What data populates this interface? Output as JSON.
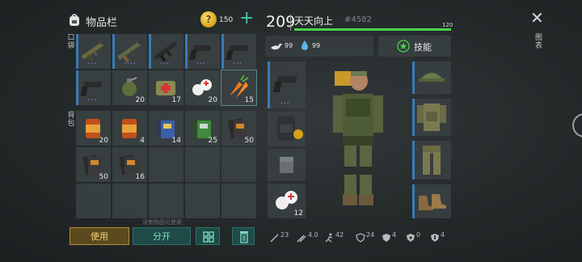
{
  "inventory": {
    "title": "物品栏",
    "coins": "150",
    "coin_symbol": "?",
    "plus_label": "+",
    "pocket_label": "口袋",
    "backpack_label": "背包",
    "pocket_items": [
      {
        "name": "rifle-ak",
        "count": "",
        "dots": "•••"
      },
      {
        "name": "rifle-camo",
        "count": "",
        "dots": "••••"
      },
      {
        "name": "rifle-black",
        "count": "",
        "dots": "•••"
      },
      {
        "name": "pistol",
        "count": "",
        "dots": "•••"
      },
      {
        "name": "pistol",
        "count": "",
        "dots": "•••"
      },
      {
        "name": "pistol",
        "count": "",
        "dots": "•••"
      },
      {
        "name": "grenade",
        "count": "20",
        "dots": ""
      },
      {
        "name": "first-aid-kit",
        "count": "17",
        "dots": ""
      },
      {
        "name": "bandage",
        "count": "20",
        "dots": ""
      },
      {
        "name": "carrots",
        "count": "15",
        "dots": ""
      }
    ],
    "backpack_items": [
      {
        "name": "canned-food",
        "count": "20"
      },
      {
        "name": "canned-food",
        "count": "4"
      },
      {
        "name": "recipe-book-blue",
        "count": "14"
      },
      {
        "name": "recipe-book-green",
        "count": "25"
      },
      {
        "name": "recipe-book",
        "count": "50"
      },
      {
        "name": "recipe-book",
        "count": "50"
      },
      {
        "name": "recipe-book",
        "count": "16"
      }
    ],
    "hint": "没有物品可使用",
    "use_label": "使用",
    "split_label": "分开"
  },
  "character": {
    "level": "209",
    "name": "天天向上",
    "id": "#4582",
    "xp_value": "120",
    "xp_fraction": 1.0,
    "food": "99",
    "water": "99",
    "skills_label": "技能",
    "weapon_slot": {
      "name": "pistol",
      "dots": "•••"
    },
    "med_slot_count": "12",
    "stats": [
      "23",
      "4.0",
      "42",
      "24",
      "4",
      "0",
      "4"
    ]
  },
  "right_panel": {
    "close_symbol": "✕",
    "label": "图表"
  },
  "colors": {
    "accent_green": "#4cd34a",
    "teal": "#47c5a8",
    "gold": "#f5d27a",
    "rarity_blue": "#3a7bb8",
    "rarity_purple": "#9c6ee0"
  }
}
